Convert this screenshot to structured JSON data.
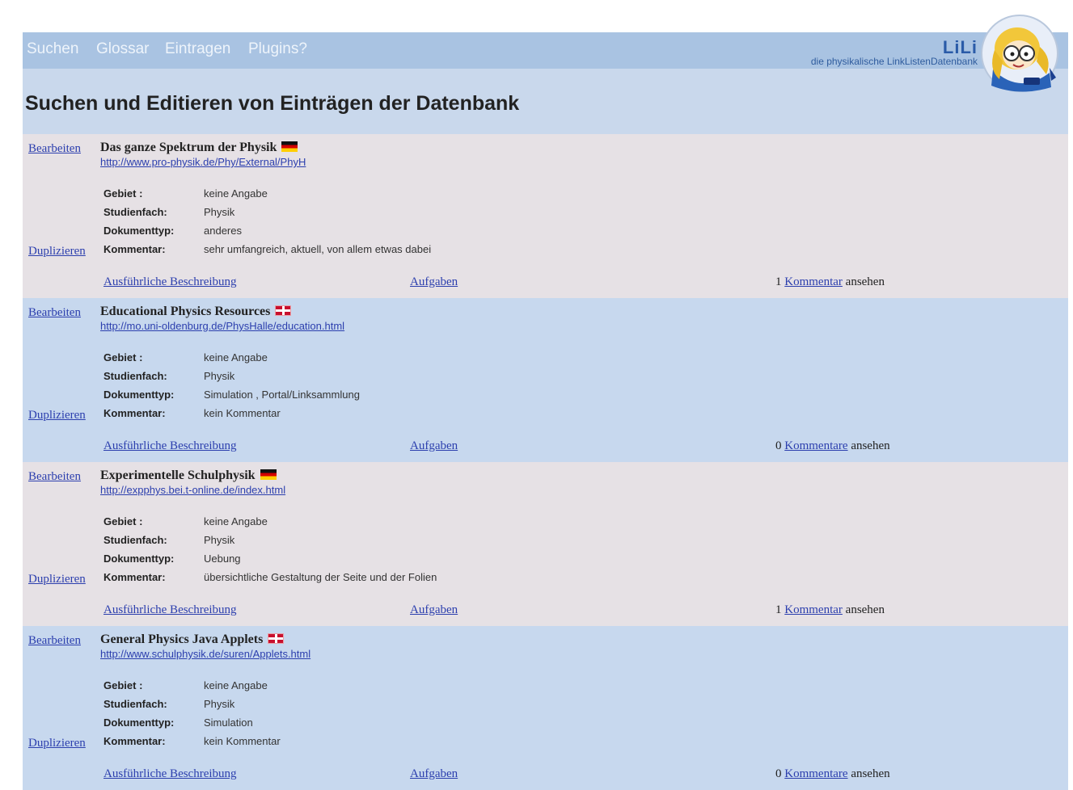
{
  "nav": {
    "items": [
      "Suchen",
      "Glossar",
      "Eintragen",
      "Plugins?"
    ]
  },
  "brand": {
    "name": "LiLi",
    "subtitle": "die physikalische LinkListenDatenbank"
  },
  "page": {
    "title": "Suchen und Editieren von Einträgen der Datenbank"
  },
  "labels": {
    "edit": "Bearbeiten",
    "duplicate": "Duplizieren",
    "gebiet": "Gebiet :",
    "studienfach": "Studienfach:",
    "dokumenttyp": "Dokumenttyp:",
    "kommentar": "Kommentar:",
    "detail": "Ausführliche Beschreibung",
    "tasks": "Aufgaben",
    "view": "ansehen"
  },
  "entries": [
    {
      "title": "Das ganze Spektrum der Physik",
      "lang": "de",
      "url": "http://www.pro-physik.de/Phy/External/PhyH",
      "gebiet": "keine Angabe",
      "studienfach": "Physik",
      "dokumenttyp": "anderes",
      "kommentar": "sehr umfangreich, aktuell, von allem etwas dabei",
      "comment_count": "1",
      "comment_word": "Kommentar"
    },
    {
      "title": "Educational Physics Resources",
      "lang": "en",
      "url": "http://mo.uni-oldenburg.de/PhysHalle/education.html",
      "gebiet": "keine Angabe",
      "studienfach": "Physik",
      "dokumenttyp": "Simulation , Portal/Linksammlung",
      "kommentar": "kein Kommentar",
      "comment_count": "0",
      "comment_word": "Kommentare"
    },
    {
      "title": "Experimentelle Schulphysik",
      "lang": "de",
      "url": "http://expphys.bei.t-online.de/index.html",
      "gebiet": "keine Angabe",
      "studienfach": "Physik",
      "dokumenttyp": "Uebung",
      "kommentar": "übersichtliche Gestaltung der Seite und der Folien",
      "comment_count": "1",
      "comment_word": "Kommentar"
    },
    {
      "title": "General Physics Java Applets",
      "lang": "en",
      "url": "http://www.schulphysik.de/suren/Applets.html",
      "gebiet": "keine Angabe",
      "studienfach": "Physik",
      "dokumenttyp": "Simulation",
      "kommentar": "kein Kommentar",
      "comment_count": "0",
      "comment_word": "Kommentare"
    }
  ],
  "colors": {
    "nav_bg": "#a9c3e2",
    "frame_bg": "#c9d8ec",
    "row_odd": "#e6e1e5",
    "row_even": "#c7d8ee",
    "link": "#2c3fae"
  }
}
